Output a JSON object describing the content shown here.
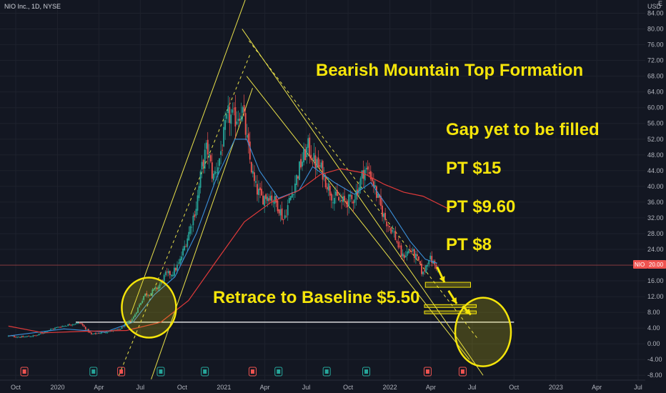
{
  "header": {
    "symbol_line": "NIO Inc., 1D, NYSE",
    "currency": "USD",
    "corner_label": "E"
  },
  "price_tag": {
    "symbol": "NIO",
    "value": "20.00"
  },
  "annotations": {
    "title": "Bearish Mountain Top Formation",
    "gap": "Gap yet to be filled",
    "pt1": "PT $15",
    "pt2": "PT $9.60",
    "pt3": "PT $8",
    "retrace": "Retrace to Baseline $5.50"
  },
  "colors": {
    "background": "#131722",
    "annotation": "#f5e50a",
    "trendline": "#e8e04a",
    "candle_up": "#26a69a",
    "candle_down": "#ef5350",
    "ma_fast": "#3a8fd8",
    "ma_slow": "#e03a3a",
    "price_line": "#ef5350",
    "baseline": "#ffffff"
  },
  "chart_data": {
    "type": "candlestick",
    "title": "NIO Inc., 1D, NYSE",
    "ylabel": "USD",
    "ylim": [
      -8.5,
      87
    ],
    "y_ticks": [
      -8,
      -4,
      0,
      4,
      8,
      12,
      16,
      20,
      24,
      28,
      32,
      36,
      40,
      44,
      48,
      52,
      56,
      60,
      64,
      68,
      72,
      76,
      80,
      84
    ],
    "y_tick_labels": [
      "-8.00",
      "-4.00",
      "0.00",
      "4.00",
      "8.00",
      "12.00",
      "16.00",
      "20.00",
      "24.00",
      "28.00",
      "32.00",
      "36.00",
      "40.00",
      "44.00",
      "48.00",
      "52.00",
      "56.00",
      "60.00",
      "64.00",
      "68.00",
      "72.00",
      "76.00",
      "80.00",
      "84.00"
    ],
    "x_ticks": [
      "2019-10-01",
      "2020-01-01",
      "2020-04-01",
      "2020-07-01",
      "2020-10-01",
      "2021-01-01",
      "2021-04-01",
      "2021-07-01",
      "2021-10-01",
      "2022-01-01",
      "2022-04-01",
      "2022-07-01",
      "2022-10-01",
      "2023-01-01",
      "2023-04-01",
      "2023-07-01"
    ],
    "x_tick_labels": [
      "Oct",
      "2020",
      "Apr",
      "Jul",
      "Oct",
      "2021",
      "Apr",
      "Jul",
      "Oct",
      "2022",
      "Apr",
      "Jul",
      "Oct",
      "2023",
      "Apr",
      "Jul"
    ],
    "price_path": [
      [
        "2019-09-15",
        2.0
      ],
      [
        "2019-10-15",
        1.7
      ],
      [
        "2019-11-15",
        2.1
      ],
      [
        "2019-12-15",
        3.6
      ],
      [
        "2020-01-01",
        4.2
      ],
      [
        "2020-02-01",
        5.0
      ],
      [
        "2020-02-20",
        5.3
      ],
      [
        "2020-03-15",
        2.4
      ],
      [
        "2020-04-15",
        3.0
      ],
      [
        "2020-05-15",
        3.6
      ],
      [
        "2020-06-15",
        6.5
      ],
      [
        "2020-07-10",
        12.5
      ],
      [
        "2020-07-25",
        13.0
      ],
      [
        "2020-08-10",
        14.5
      ],
      [
        "2020-08-25",
        17.5
      ],
      [
        "2020-09-10",
        18.0
      ],
      [
        "2020-09-25",
        20.5
      ],
      [
        "2020-10-15",
        28.0
      ],
      [
        "2020-11-01",
        35.0
      ],
      [
        "2020-11-15",
        46.0
      ],
      [
        "2020-11-25",
        50.0
      ],
      [
        "2020-12-08",
        42.0
      ],
      [
        "2020-12-20",
        46.0
      ],
      [
        "2021-01-10",
        58.0
      ],
      [
        "2021-01-25",
        57.0
      ],
      [
        "2021-02-10",
        60.0
      ],
      [
        "2021-02-25",
        48.0
      ],
      [
        "2021-03-10",
        40.0
      ],
      [
        "2021-03-25",
        37.0
      ],
      [
        "2021-04-10",
        38.0
      ],
      [
        "2021-05-01",
        35.0
      ],
      [
        "2021-05-12",
        31.5
      ],
      [
        "2021-06-01",
        39.0
      ],
      [
        "2021-06-20",
        46.0
      ],
      [
        "2021-07-05",
        50.0
      ],
      [
        "2021-07-20",
        46.0
      ],
      [
        "2021-08-05",
        44.0
      ],
      [
        "2021-08-25",
        38.0
      ],
      [
        "2021-09-15",
        36.0
      ],
      [
        "2021-10-10",
        36.5
      ],
      [
        "2021-10-25",
        40.0
      ],
      [
        "2021-11-05",
        44.5
      ],
      [
        "2021-11-20",
        43.0
      ],
      [
        "2021-12-05",
        37.0
      ],
      [
        "2021-12-20",
        32.0
      ],
      [
        "2022-01-10",
        28.0
      ],
      [
        "2022-01-28",
        22.0
      ],
      [
        "2022-02-15",
        24.0
      ],
      [
        "2022-03-05",
        21.0
      ],
      [
        "2022-03-14",
        17.5
      ],
      [
        "2022-03-28",
        22.0
      ],
      [
        "2022-04-10",
        20.0
      ],
      [
        "2022-04-18",
        19.0
      ]
    ],
    "ma_fast_path": [
      [
        "2019-09-15",
        2.0
      ],
      [
        "2020-01-15",
        3.8
      ],
      [
        "2020-04-15",
        3.0
      ],
      [
        "2020-06-15",
        5.5
      ],
      [
        "2020-08-01",
        12.5
      ],
      [
        "2020-09-15",
        17.0
      ],
      [
        "2020-11-01",
        28.0
      ],
      [
        "2020-12-15",
        42.0
      ],
      [
        "2021-01-25",
        52.0
      ],
      [
        "2021-02-20",
        52.0
      ],
      [
        "2021-03-20",
        44.0
      ],
      [
        "2021-05-01",
        37.0
      ],
      [
        "2021-06-15",
        39.0
      ],
      [
        "2021-07-15",
        45.0
      ],
      [
        "2021-09-01",
        41.0
      ],
      [
        "2021-10-15",
        38.0
      ],
      [
        "2021-11-20",
        41.0
      ],
      [
        "2022-01-01",
        34.0
      ],
      [
        "2022-02-15",
        26.0
      ],
      [
        "2022-03-20",
        21.5
      ],
      [
        "2022-04-15",
        20.5
      ]
    ],
    "ma_slow_path": [
      [
        "2019-09-15",
        4.5
      ],
      [
        "2019-12-01",
        2.8
      ],
      [
        "2020-03-01",
        3.2
      ],
      [
        "2020-06-01",
        3.4
      ],
      [
        "2020-08-15",
        5.5
      ],
      [
        "2020-10-15",
        11.0
      ],
      [
        "2020-12-15",
        21.0
      ],
      [
        "2021-02-15",
        31.0
      ],
      [
        "2021-04-15",
        36.0
      ],
      [
        "2021-06-15",
        39.0
      ],
      [
        "2021-08-01",
        43.0
      ],
      [
        "2021-09-15",
        44.5
      ],
      [
        "2021-11-01",
        43.5
      ],
      [
        "2021-12-20",
        40.5
      ],
      [
        "2022-02-01",
        38.5
      ],
      [
        "2022-03-15",
        37.5
      ],
      [
        "2022-05-15",
        34.0
      ]
    ],
    "trendlines": [
      {
        "x1": "2020-06-10",
        "y1": 7.5,
        "x2": "2021-02-25",
        "y2": 90,
        "style": "solid"
      },
      {
        "x1": "2020-07-25",
        "y1": -9,
        "x2": "2021-03-05",
        "y2": 65,
        "style": "solid"
      },
      {
        "x1": "2021-02-10",
        "y1": 80,
        "x2": "2022-07-25",
        "y2": -8,
        "style": "solid"
      },
      {
        "x1": "2021-02-20",
        "y1": 68,
        "x2": "2022-06-25",
        "y2": -4,
        "style": "solid"
      },
      {
        "x1": "2021-02-25",
        "y1": 77,
        "x2": "2022-07-15",
        "y2": 1,
        "style": "dashed"
      },
      {
        "x1": "2020-05-15",
        "y1": -8,
        "x2": "2021-03-01",
        "y2": 74,
        "style": "dashed"
      }
    ],
    "baseline_level": 5.5,
    "current_price": 20.0,
    "target_bands": [
      15,
      9.6,
      8
    ],
    "earnings_markers": [
      {
        "date": "2019-10-20",
        "type": "red"
      },
      {
        "date": "2020-03-20",
        "type": "green"
      },
      {
        "date": "2020-05-20",
        "type": "red"
      },
      {
        "date": "2020-08-15",
        "type": "green"
      },
      {
        "date": "2020-11-20",
        "type": "green"
      },
      {
        "date": "2021-03-05",
        "type": "red"
      },
      {
        "date": "2021-05-01",
        "type": "green"
      },
      {
        "date": "2021-08-15",
        "type": "green"
      },
      {
        "date": "2021-11-10",
        "type": "green"
      },
      {
        "date": "2022-03-25",
        "type": "red"
      },
      {
        "date": "2022-06-10",
        "type": "red"
      }
    ]
  }
}
